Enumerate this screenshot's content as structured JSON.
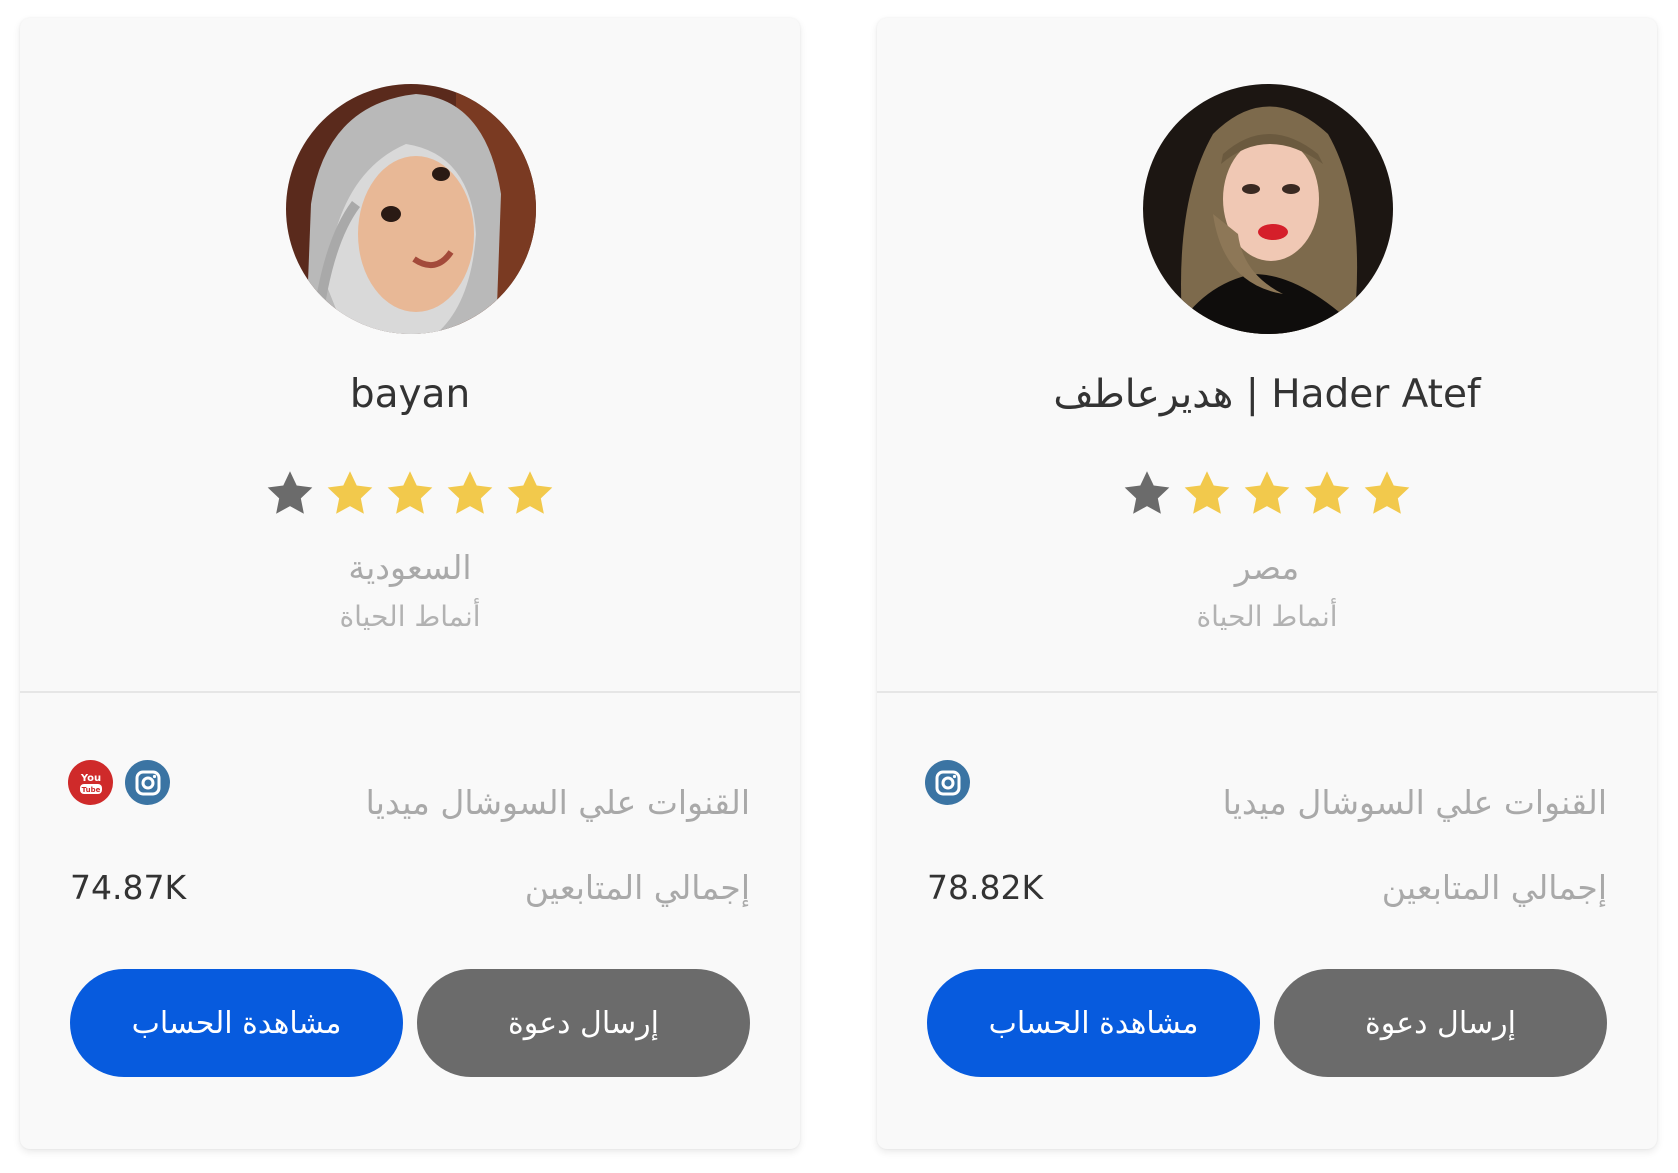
{
  "cards": [
    {
      "name": "bayan",
      "rating": 4,
      "rating_max": 5,
      "country": "السعودية",
      "category": "أنماط الحياة",
      "channels_label": "القنوات علي السوشال ميديا",
      "channels": [
        "youtube-icon",
        "instagram-icon"
      ],
      "followers_label": "إجمالي المتابعين",
      "followers_value": "74.87K",
      "view_button": "مشاهدة الحساب",
      "invite_button": "إرسال دعوة"
    },
    {
      "name": "هديرعاطف | Hader Atef",
      "rating": 4,
      "rating_max": 5,
      "country": "مصر",
      "category": "أنماط الحياة",
      "channels_label": "القنوات علي السوشال ميديا",
      "channels": [
        "instagram-icon"
      ],
      "followers_label": "إجمالي المتابعين",
      "followers_value": "78.82K",
      "view_button": "مشاهدة الحساب",
      "invite_button": "إرسال دعوة"
    }
  ],
  "colors": {
    "star_filled": "#f2c94c",
    "star_empty": "#6b6b6b",
    "primary_button": "#075bde",
    "secondary_button": "#6b6b6b",
    "instagram": "#3b74a3",
    "youtube": "#cf2a2a"
  }
}
